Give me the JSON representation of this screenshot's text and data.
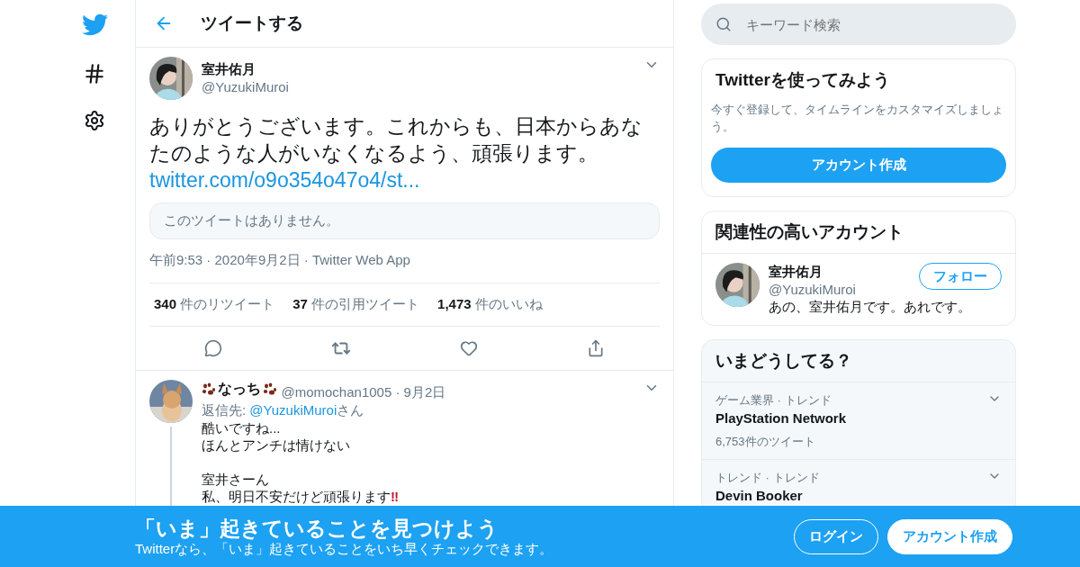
{
  "header": {
    "title": "ツイートする"
  },
  "tweet": {
    "name": "室井佑月",
    "handle": "@YuzukiMuroi",
    "text": "ありがとうございます。これからも、日本からあなたのような人がいなくなるよう、頑張ります。",
    "link": "twitter.com/o9o354o47o4/st...",
    "quote_notice": "このツイートはありません。",
    "meta": "午前9:53 · 2020年9月2日 · Twitter Web App",
    "stats": [
      {
        "count": "340",
        "label": "件のリツイート"
      },
      {
        "count": "37",
        "label": "件の引用ツイート"
      },
      {
        "count": "1,473",
        "label": "件のいいね"
      }
    ]
  },
  "reply": {
    "name": "なっち",
    "meta": "@momochan1005 · 9月2日",
    "reply_prefix": "返信先: ",
    "reply_to": "@YuzukiMuroi",
    "reply_suffix": "さん",
    "paragraphs": [
      [
        "酷いですね...",
        "ほんとアンチは情けない"
      ],
      [
        "室井さーん",
        "私、明日不安だけど頑張ります"
      ]
    ],
    "mark": "‼"
  },
  "search": {
    "placeholder": "キーワード検索"
  },
  "signup_card": {
    "title": "Twitterを使ってみよう",
    "text": "今すぐ登録して、タイムラインをカスタマイズしましょう。",
    "button": "アカウント作成"
  },
  "relevant": {
    "title": "関連性の高いアカウント",
    "accounts": [
      {
        "name": "室井佑月",
        "handle": "@YuzukiMuroi",
        "bio": "あの、室井佑月です。あれです。",
        "button": "フォロー"
      }
    ]
  },
  "trends": {
    "title": "いまどうしてる？",
    "items": [
      {
        "context": "ゲーム業界 · トレンド",
        "name": "PlayStation Network",
        "count": "6,753件のツイート"
      },
      {
        "context": "トレンド · トレンド",
        "name": "Devin Booker"
      }
    ]
  },
  "banner": {
    "title": "「いま」起きていることを見つけよう",
    "subtitle": "Twitterなら、「いま」起きていることをいち早くチェックできます。",
    "buttons": [
      {
        "label": "ログイン",
        "kind": "outline"
      },
      {
        "label": "アカウント作成",
        "kind": "solid"
      }
    ]
  }
}
